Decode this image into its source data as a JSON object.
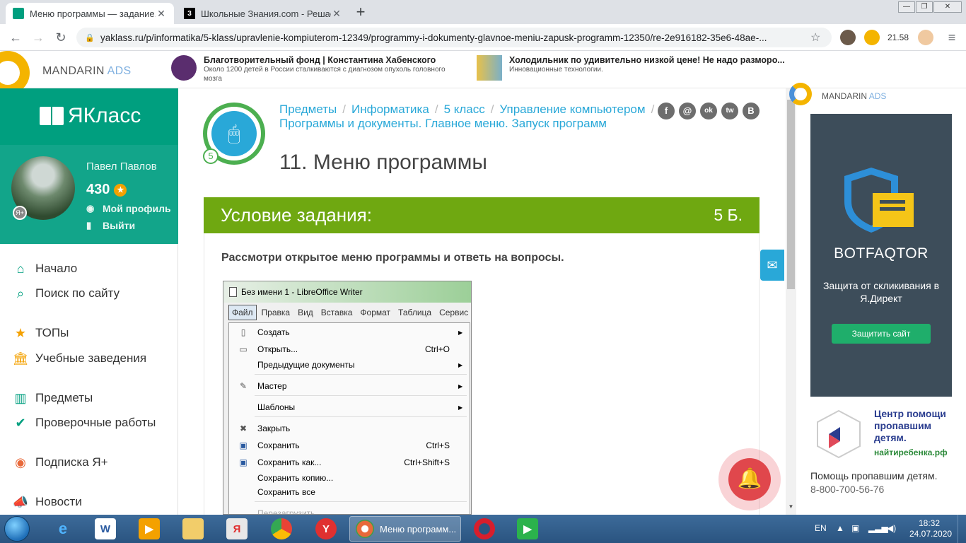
{
  "browser": {
    "tabs": [
      {
        "label": "Меню программы — задание. Я",
        "active": true
      },
      {
        "label": "Школьные Знания.com - Решае",
        "active": false
      }
    ],
    "new_tab": "+",
    "url": "yaklass.ru/p/informatika/5-klass/upravlenie-kompiuterom-12349/programmy-i-dokumenty-glavnoe-meniu-zapusk-programm-12350/re-2e916182-35e6-48ae-...",
    "ext_badge": "21.58"
  },
  "top_ads": {
    "network_name": "MANDARIN",
    "network_suffix": "ADS",
    "ad1": {
      "title": "Благотворительный фонд | Константина Хабенского",
      "text": "Около 1200 детей в России сталкиваются с диагнозом опухоль головного мозга"
    },
    "ad2": {
      "title": "Холодильник по удивительно низкой цене! Не надо разморо...",
      "text": "Инновационные технологии."
    }
  },
  "sidebar": {
    "brand": "ЯКласс",
    "user_name": "Павел Павлов",
    "points": "430",
    "profile_link": "Мой профиль",
    "logout_link": "Выйти",
    "nav": [
      {
        "label": "Начало",
        "icon": "home-icon"
      },
      {
        "label": "Поиск по сайту",
        "icon": "search-icon"
      },
      {
        "label": "ТОПы",
        "icon": "star-icon"
      },
      {
        "label": "Учебные заведения",
        "icon": "school-icon"
      },
      {
        "label": "Предметы",
        "icon": "book-icon"
      },
      {
        "label": "Проверочные работы",
        "icon": "check-icon"
      },
      {
        "label": "Подписка Я+",
        "icon": "ya-plus-icon"
      },
      {
        "label": "Новости",
        "icon": "megaphone-icon"
      }
    ]
  },
  "main": {
    "grade": "5",
    "breadcrumbs": [
      "Предметы",
      "Информатика",
      "5 класс",
      "Управление компьютером",
      "Программы и документы. Главное меню. Запуск программ"
    ],
    "title": "11. Меню программы",
    "task_header": "Условие задания:",
    "score": "5 Б.",
    "question": "Рассмотри открытое меню программы и ответь на вопросы.",
    "social": [
      "f",
      "@",
      "ok",
      "tw",
      "B"
    ]
  },
  "writer_shot": {
    "window_title": "Без имени 1 - LibreOffice Writer",
    "menubar": [
      "Файл",
      "Правка",
      "Вид",
      "Вставка",
      "Формат",
      "Таблица",
      "Сервис"
    ],
    "items": [
      {
        "label": "Создать",
        "shortcut": "",
        "submenu": true
      },
      {
        "label": "Открыть...",
        "shortcut": "Ctrl+O",
        "submenu": false
      },
      {
        "label": "Предыдущие документы",
        "shortcut": "",
        "submenu": true
      },
      {
        "label": "Мастер",
        "shortcut": "",
        "submenu": true
      },
      {
        "label": "Шаблоны",
        "shortcut": "",
        "submenu": true
      },
      {
        "label": "Закрыть",
        "shortcut": "",
        "submenu": false
      },
      {
        "label": "Сохранить",
        "shortcut": "Ctrl+S",
        "submenu": false
      },
      {
        "label": "Сохранить как...",
        "shortcut": "Ctrl+Shift+S",
        "submenu": false
      },
      {
        "label": "Сохранить копию...",
        "shortcut": "",
        "submenu": false
      },
      {
        "label": "Сохранить все",
        "shortcut": "",
        "submenu": false
      },
      {
        "label": "Перезагрузить",
        "shortcut": "",
        "submenu": false
      }
    ]
  },
  "right_ads": {
    "network_name": "MANDARIN",
    "network_suffix": "ADS",
    "bot_name": "BOTFAQTOR",
    "bot_text": "Защита от скликивания в Я.Директ",
    "bot_button": "Защитить сайт",
    "center_title": "Центр помощи пропавшим детям.",
    "center_site": "найтиребенка.рф",
    "help_text": "Помощь пропавшим детям.",
    "phone": "8-800-700-56-76"
  },
  "taskbar": {
    "active_task": "Меню программ...",
    "lang": "EN",
    "time": "18:32",
    "date": "24.07.2020"
  },
  "colors": {
    "brand_green": "#009f7f",
    "task_green": "#6fa811",
    "link_blue": "#29a8d8",
    "bell_red": "#e0474c"
  }
}
